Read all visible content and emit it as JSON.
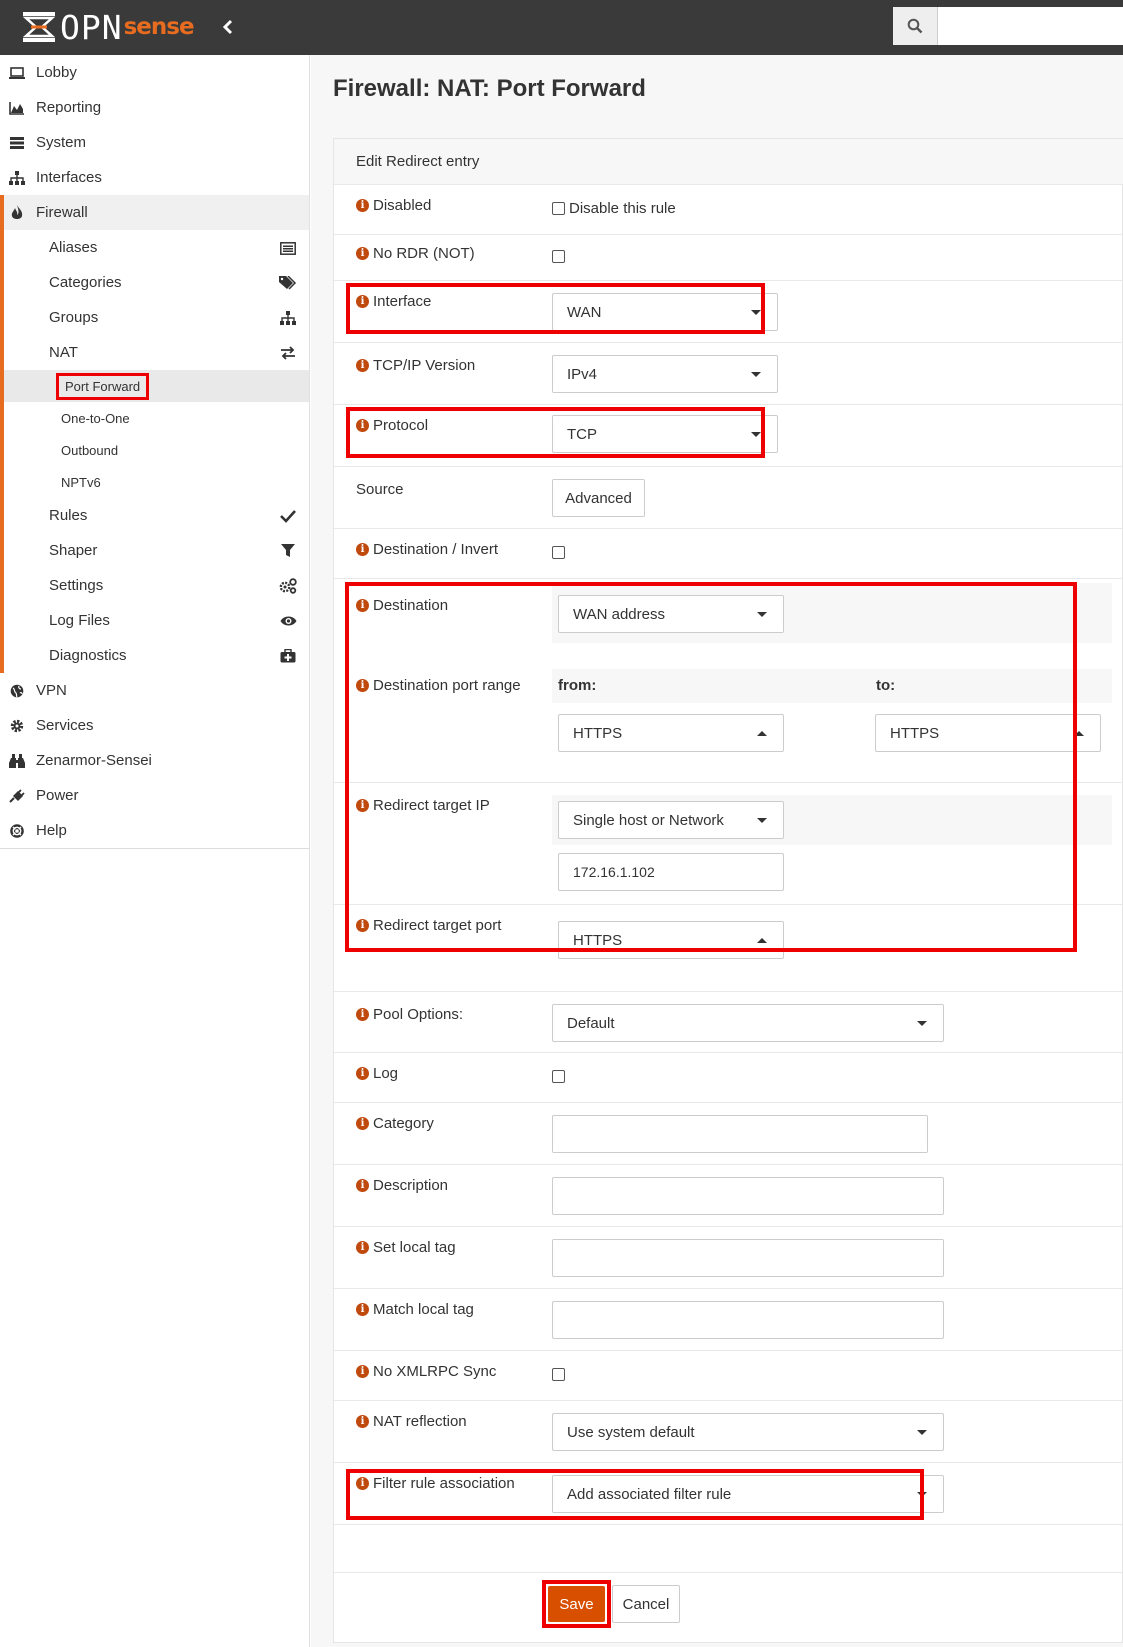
{
  "brand": {
    "logo_text": "OPN",
    "logo_sense": "sense"
  },
  "sidebar": {
    "items": [
      {
        "label": "Lobby",
        "icon": "laptop-icon"
      },
      {
        "label": "Reporting",
        "icon": "area-chart-icon"
      },
      {
        "label": "System",
        "icon": "server-icon"
      },
      {
        "label": "Interfaces",
        "icon": "sitemap-icon"
      },
      {
        "label": "Firewall",
        "icon": "fire-icon"
      }
    ],
    "firewall_sub": [
      {
        "label": "Aliases",
        "icon": "list-alt-icon"
      },
      {
        "label": "Categories",
        "icon": "tags-icon"
      },
      {
        "label": "Groups",
        "icon": "sitemap-icon"
      },
      {
        "label": "NAT",
        "icon": "exchange-icon"
      }
    ],
    "nat_sub": [
      {
        "label": "Port Forward"
      },
      {
        "label": "One-to-One"
      },
      {
        "label": "Outbound"
      },
      {
        "label": "NPTv6"
      }
    ],
    "firewall_sub2": [
      {
        "label": "Rules",
        "icon": "check-icon"
      },
      {
        "label": "Shaper",
        "icon": "filter-icon"
      },
      {
        "label": "Settings",
        "icon": "cogs-icon"
      },
      {
        "label": "Log Files",
        "icon": "eye-icon"
      },
      {
        "label": "Diagnostics",
        "icon": "medkit-icon"
      }
    ],
    "items2": [
      {
        "label": "VPN",
        "icon": "globe-icon"
      },
      {
        "label": "Services",
        "icon": "cog-icon"
      },
      {
        "label": "Zenarmor-Sensei",
        "icon": "binoculars-icon"
      },
      {
        "label": "Power",
        "icon": "plug-icon"
      },
      {
        "label": "Help",
        "icon": "life-ring-icon"
      }
    ]
  },
  "page": {
    "title": "Firewall: NAT: Port Forward",
    "panel_header": "Edit Redirect entry"
  },
  "form": {
    "disabled": {
      "label": "Disabled",
      "checkbox_label": "Disable this rule"
    },
    "no_rdr": {
      "label": "No RDR (NOT)"
    },
    "interface": {
      "label": "Interface",
      "value": "WAN"
    },
    "tcpip": {
      "label": "TCP/IP Version",
      "value": "IPv4"
    },
    "protocol": {
      "label": "Protocol",
      "value": "TCP"
    },
    "source": {
      "label": "Source",
      "button": "Advanced"
    },
    "dest_invert": {
      "label": "Destination / Invert"
    },
    "destination": {
      "label": "Destination",
      "value": "WAN address"
    },
    "dest_port": {
      "label": "Destination port range",
      "from_label": "from:",
      "to_label": "to:",
      "from_value": "HTTPS",
      "to_value": "HTTPS"
    },
    "redirect_ip": {
      "label": "Redirect target IP",
      "type_value": "Single host or Network",
      "address": "172.16.1.102"
    },
    "redirect_port": {
      "label": "Redirect target port",
      "value": "HTTPS"
    },
    "pool": {
      "label": "Pool Options:",
      "value": "Default"
    },
    "log": {
      "label": "Log"
    },
    "category": {
      "label": "Category",
      "value": ""
    },
    "description": {
      "label": "Description",
      "value": ""
    },
    "set_tag": {
      "label": "Set local tag",
      "value": ""
    },
    "match_tag": {
      "label": "Match local tag",
      "value": ""
    },
    "no_xmlrpc": {
      "label": "No XMLRPC Sync"
    },
    "nat_reflection": {
      "label": "NAT reflection",
      "value": "Use system default"
    },
    "filter_rule": {
      "label": "Filter rule association",
      "value": "Add associated filter rule"
    }
  },
  "actions": {
    "save": "Save",
    "cancel": "Cancel"
  },
  "colors": {
    "accent": "#e86c1f",
    "highlight_box": "#ee0000",
    "save_button": "#d94f00",
    "topbar": "#3a3a3a"
  }
}
